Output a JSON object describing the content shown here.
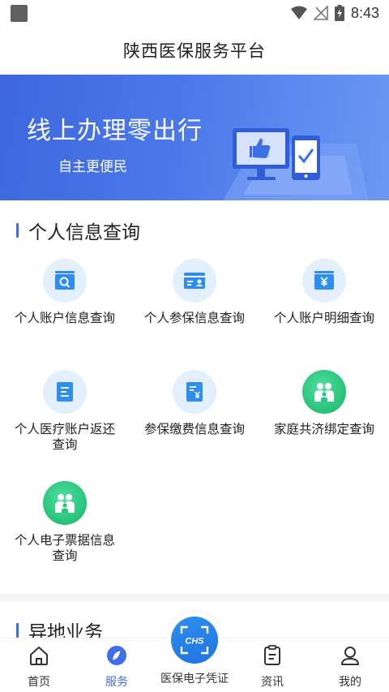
{
  "status_bar": {
    "time": "8:43"
  },
  "header": {
    "title": "陕西医保服务平台"
  },
  "banner": {
    "title": "线上办理零出行",
    "subtitle": "自主更便民"
  },
  "section_personal": {
    "title": "个人信息查询",
    "items": [
      {
        "label": "个人账户信息查询",
        "icon": "account-search-icon"
      },
      {
        "label": "个人参保信息查询",
        "icon": "insurance-card-icon"
      },
      {
        "label": "个人账户明细查询",
        "icon": "yuan-wallet-icon"
      },
      {
        "label": "个人医疗账户返还查询",
        "icon": "document-list-icon"
      },
      {
        "label": "参保缴费信息查询",
        "icon": "payment-receipt-icon"
      },
      {
        "label": "家庭共济绑定查询",
        "icon": "family-icon"
      },
      {
        "label": "个人电子票据信息查询",
        "icon": "family-icon"
      }
    ]
  },
  "section_remote": {
    "title": "异地业务"
  },
  "bottom_nav": {
    "items": [
      {
        "label": "首页",
        "icon": "home-icon"
      },
      {
        "label": "服务",
        "icon": "service-compass-icon",
        "active": true
      },
      {
        "label": "医保电子凭证",
        "icon": "chs-scan-icon"
      },
      {
        "label": "资讯",
        "icon": "news-clipboard-icon"
      },
      {
        "label": "我的",
        "icon": "user-icon"
      }
    ]
  },
  "colors": {
    "accent": "#3f6fe6",
    "banner": "#4a78e9",
    "green": "#2cc57e",
    "icon_bg": "#e3effc"
  }
}
